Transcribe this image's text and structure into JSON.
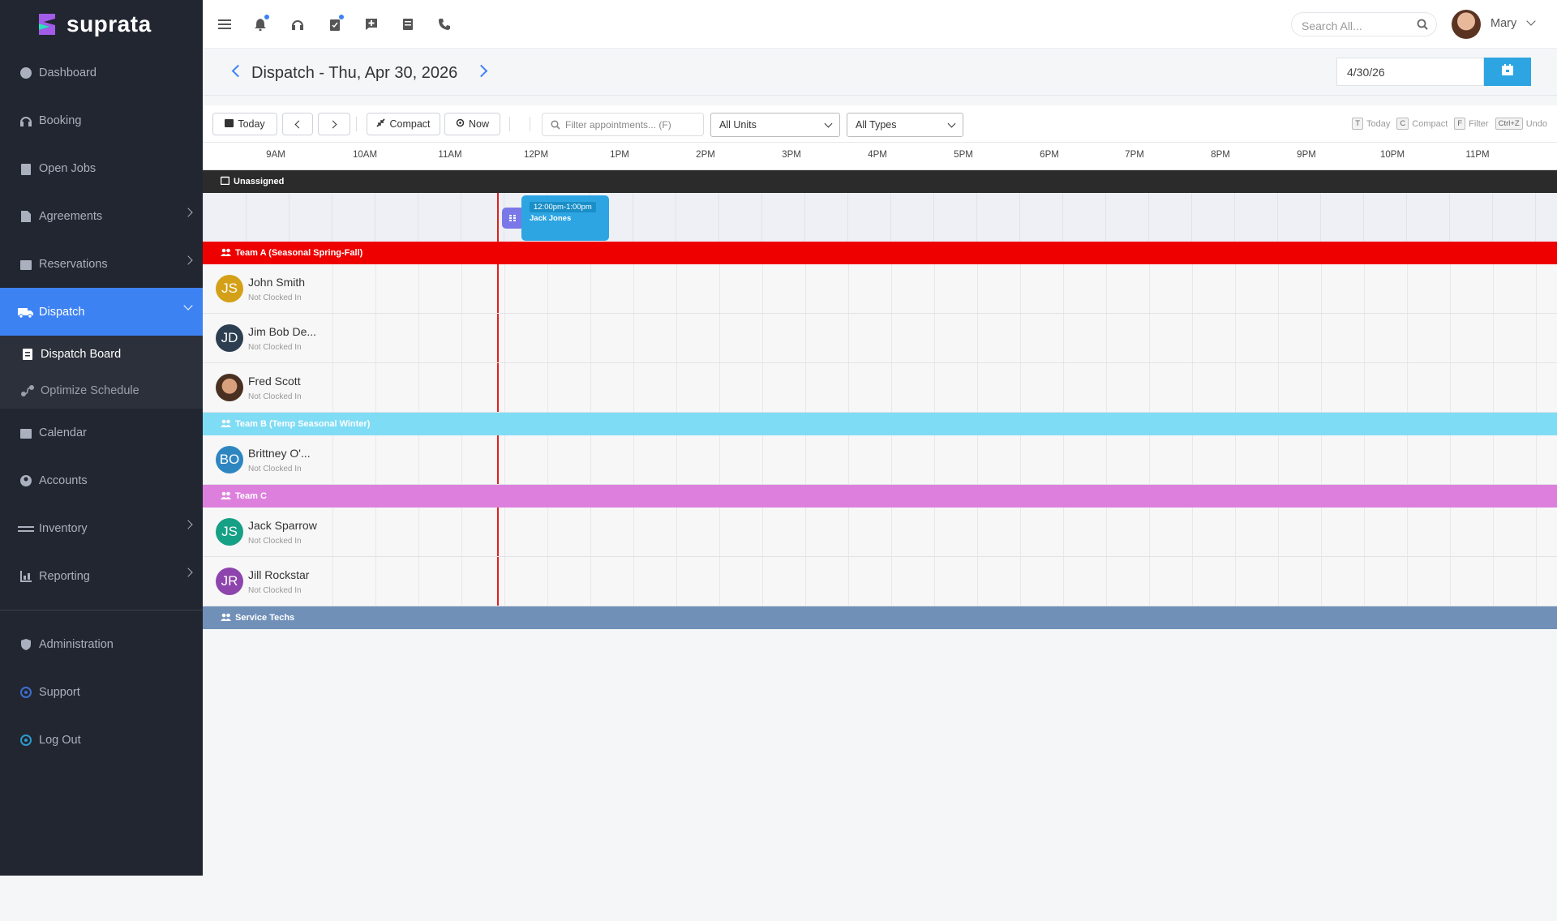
{
  "brand": {
    "name": "suprata"
  },
  "sidebar": {
    "items": [
      {
        "label": "Dashboard",
        "icon": "dashboard-icon"
      },
      {
        "label": "Booking",
        "icon": "headset-icon"
      },
      {
        "label": "Open Jobs",
        "icon": "clipboard-icon"
      },
      {
        "label": "Agreements",
        "icon": "document-icon",
        "expandable": true
      },
      {
        "label": "Reservations",
        "icon": "calendar-check-icon",
        "expandable": true
      },
      {
        "label": "Dispatch",
        "icon": "truck-icon",
        "expandable": true,
        "active": true
      },
      {
        "label": "Calendar",
        "icon": "calendar-icon"
      },
      {
        "label": "Accounts",
        "icon": "user-icon"
      },
      {
        "label": "Inventory",
        "icon": "pallet-icon",
        "expandable": true
      },
      {
        "label": "Reporting",
        "icon": "chart-icon",
        "expandable": true
      }
    ],
    "dispatch_sub": [
      {
        "label": "Dispatch Board",
        "icon": "clipboard-list-icon"
      },
      {
        "label": "Optimize Schedule",
        "icon": "route-icon"
      }
    ],
    "bottom": [
      {
        "label": "Administration",
        "icon": "shield-icon"
      },
      {
        "label": "Support",
        "icon": "support-icon"
      },
      {
        "label": "Log Out",
        "icon": "logout-icon"
      }
    ]
  },
  "topbar": {
    "search_placeholder": "Search All...",
    "user_name": "Mary",
    "icons": [
      "menu-icon",
      "bell-icon",
      "headset-icon",
      "checklist-icon",
      "comment-plus-icon",
      "document-icon",
      "phone-icon"
    ]
  },
  "header": {
    "title": "Dispatch - Thu, Apr 30, 2026",
    "date_value": "4/30/26"
  },
  "toolbar": {
    "today": "Today",
    "compact": "Compact",
    "now": "Now",
    "filter_placeholder": "Filter appointments... (F)",
    "units": "All Units",
    "types": "All Types",
    "hints": [
      {
        "key": "T",
        "label": "Today"
      },
      {
        "key": "C",
        "label": "Compact"
      },
      {
        "key": "F",
        "label": "Filter"
      },
      {
        "key": "Ctrl+Z",
        "label": "Undo"
      }
    ]
  },
  "hours": [
    "9AM",
    "10AM",
    "11AM",
    "12PM",
    "1PM",
    "2PM",
    "3PM",
    "4PM",
    "5PM",
    "6PM",
    "7PM",
    "8PM",
    "9PM",
    "10PM",
    "11PM"
  ],
  "unassigned": {
    "label": "Unassigned",
    "appointment": {
      "time": "12:00pm-1:00pm",
      "name": "Jack Jones"
    }
  },
  "groups": [
    {
      "name": "Team A (Seasonal Spring-Fall)",
      "color": "#ee0000",
      "techs": [
        {
          "initials": "JS",
          "name": "John Smith",
          "status": "Not Clocked In",
          "color": "#d4a017"
        },
        {
          "initials": "JD",
          "name": "Jim Bob De...",
          "status": "Not Clocked In",
          "color": "#2c3e50"
        },
        {
          "initials": "",
          "name": "Fred Scott",
          "status": "Not Clocked In",
          "color": "#6b4a33"
        }
      ]
    },
    {
      "name": "Team B (Temp Seasonal Winter)",
      "color": "#7fdcf5",
      "techs": [
        {
          "initials": "BO",
          "name": "Brittney O'...",
          "status": "Not Clocked In",
          "color": "#2e86c1"
        }
      ]
    },
    {
      "name": "Team C",
      "color": "#dd80dd",
      "techs": [
        {
          "initials": "JS",
          "name": "Jack Sparrow",
          "status": "Not Clocked In",
          "color": "#16a085"
        },
        {
          "initials": "JR",
          "name": "Jill Rockstar",
          "status": "Not Clocked In",
          "color": "#8e44ad"
        }
      ]
    },
    {
      "name": "Service Techs",
      "color": "#7090b8",
      "techs": []
    }
  ]
}
